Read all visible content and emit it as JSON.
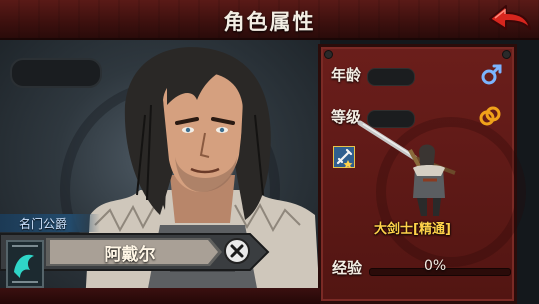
{
  "header": {
    "title": "角色属性",
    "back_icon": "back-arrow-icon"
  },
  "hero": {
    "title_tag": "名门公爵",
    "name": "阿戴尔"
  },
  "stats": {
    "age_label": "年龄",
    "level_label": "等级",
    "gender_icon": "male-icon",
    "ring_icon": "ring-icon",
    "skill_icon": "sword-skill-icon"
  },
  "unit": {
    "class_name": "大剑士[精通]"
  },
  "experience": {
    "label": "经验",
    "value_text": "0%",
    "progress": 0
  },
  "colors": {
    "header": "#4a1412",
    "panel": "#5e1916",
    "class_text": "#ffd24a",
    "title_tag": "#234b6c",
    "gender_icon": "#7bb4ff",
    "ring_icon": "#f0a21a"
  }
}
